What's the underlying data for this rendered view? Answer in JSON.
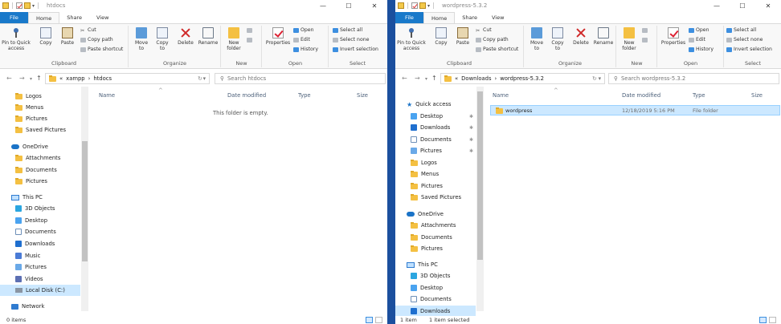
{
  "left": {
    "window_title": "htdocs",
    "tabs": [
      "File",
      "Home",
      "Share",
      "View"
    ],
    "ribbon": {
      "clipboard": {
        "pin": "Pin to Quick access",
        "copy": "Copy",
        "paste": "Paste",
        "cut": "Cut",
        "copy_path": "Copy path",
        "paste_shortcut": "Paste shortcut",
        "label": "Clipboard"
      },
      "organize": {
        "move": "Move to",
        "copy": "Copy to",
        "delete": "Delete",
        "rename": "Rename",
        "label": "Organize"
      },
      "new": {
        "new_folder": "New folder",
        "label": "New"
      },
      "open": {
        "properties": "Properties",
        "open": "Open",
        "edit": "Edit",
        "history": "History",
        "label": "Open"
      },
      "select": {
        "select_all": "Select all",
        "select_none": "Select none",
        "invert": "Invert selection",
        "label": "Select"
      }
    },
    "address": {
      "chevron": "«",
      "part1": "xampp",
      "sep": "›",
      "part2": "htdocs",
      "search_placeholder": "Search htdocs"
    },
    "nav_tree": [
      "Logos",
      "Menus",
      "Pictures",
      "Saved Pictures",
      "OneDrive",
      "Attachments",
      "Documents",
      "Pictures",
      "This PC",
      "3D Objects",
      "Desktop",
      "Documents",
      "Downloads",
      "Music",
      "Pictures",
      "Videos",
      "Local Disk (C:)",
      "Network"
    ],
    "columns": {
      "name": "Name",
      "date": "Date modified",
      "type": "Type",
      "size": "Size"
    },
    "empty_msg": "This folder is empty.",
    "status": {
      "items": "0 items"
    }
  },
  "right": {
    "window_title": "wordpress-5.3.2",
    "tabs": [
      "File",
      "Home",
      "Share",
      "View"
    ],
    "ribbon": {
      "clipboard": {
        "pin": "Pin to Quick access",
        "copy": "Copy",
        "paste": "Paste",
        "cut": "Cut",
        "copy_path": "Copy path",
        "paste_shortcut": "Paste shortcut",
        "label": "Clipboard"
      },
      "organize": {
        "move": "Move to",
        "copy": "Copy to",
        "delete": "Delete",
        "rename": "Rename",
        "label": "Organize"
      },
      "new": {
        "new_folder": "New folder",
        "label": "New"
      },
      "open": {
        "properties": "Properties",
        "open": "Open",
        "edit": "Edit",
        "history": "History",
        "label": "Open"
      },
      "select": {
        "select_all": "Select all",
        "select_none": "Select none",
        "invert": "Invert selection",
        "label": "Select"
      }
    },
    "address": {
      "chevron": "«",
      "part1": "Downloads",
      "sep": "›",
      "part2": "wordpress-5.3.2",
      "search_placeholder": "Search wordpress-5.3.2"
    },
    "nav_tree": [
      "Quick access",
      "Desktop",
      "Downloads",
      "Documents",
      "Pictures",
      "Logos",
      "Menus",
      "Pictures",
      "Saved Pictures",
      "OneDrive",
      "Attachments",
      "Documents",
      "Pictures",
      "This PC",
      "3D Objects",
      "Desktop",
      "Documents",
      "Downloads"
    ],
    "columns": {
      "name": "Name",
      "date": "Date modified",
      "type": "Type",
      "size": "Size"
    },
    "files": [
      {
        "name": "wordpress",
        "date": "12/18/2019 5:16 PM",
        "type": "File folder",
        "size": ""
      }
    ],
    "status": {
      "items": "1 item",
      "selected": "1 item selected"
    }
  },
  "colors": {
    "file_tab": "#1979ca",
    "selection": "#cce8ff",
    "taskbar_gap": "#1b4f9e"
  }
}
